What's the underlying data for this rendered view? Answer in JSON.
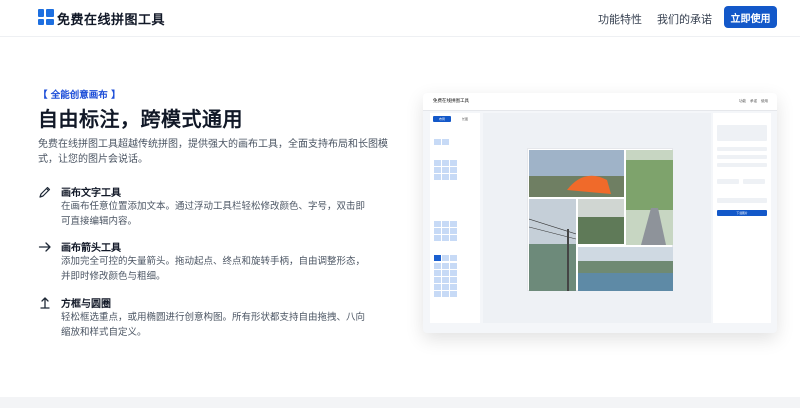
{
  "brand": {
    "name": "免费在线拼图工具",
    "accent": "#1358c9"
  },
  "nav": {
    "features": "功能特性",
    "promise": "我们的承诺",
    "cta": "立即使用"
  },
  "hero": {
    "eyebrow": "【 全能创意画布 】",
    "title": "自由标注，跨模式通用",
    "description": "免费在线拼图工具超越传统拼图，提供强大的画布工具，全面支持布局和长图模式，让您的图片会说话。"
  },
  "features": [
    {
      "icon": "pencil-icon",
      "title": "画布文字工具",
      "description": "在画布任意位置添加文本。通过浮动工具栏轻松修改颜色、字号，双击即可直接编辑内容。"
    },
    {
      "icon": "arrow-right-icon",
      "title": "画布箭头工具",
      "description": "添加完全可控的矢量箭头。拖动起点、终点和旋转手柄，自由调整形态，并即时修改颜色与粗细。"
    },
    {
      "icon": "crop-icon",
      "title": "方框与圆圈",
      "description": "轻松框选重点，或用椭圆进行创意构图。所有形状都支持自由拖拽、八向缩放和样式自定义。"
    }
  ],
  "preview": {
    "title": "免费在线拼图工具",
    "nav": [
      "功能",
      "承诺",
      "使用"
    ],
    "tabs": [
      "布局",
      "长图"
    ],
    "right_button": "下载图片"
  }
}
